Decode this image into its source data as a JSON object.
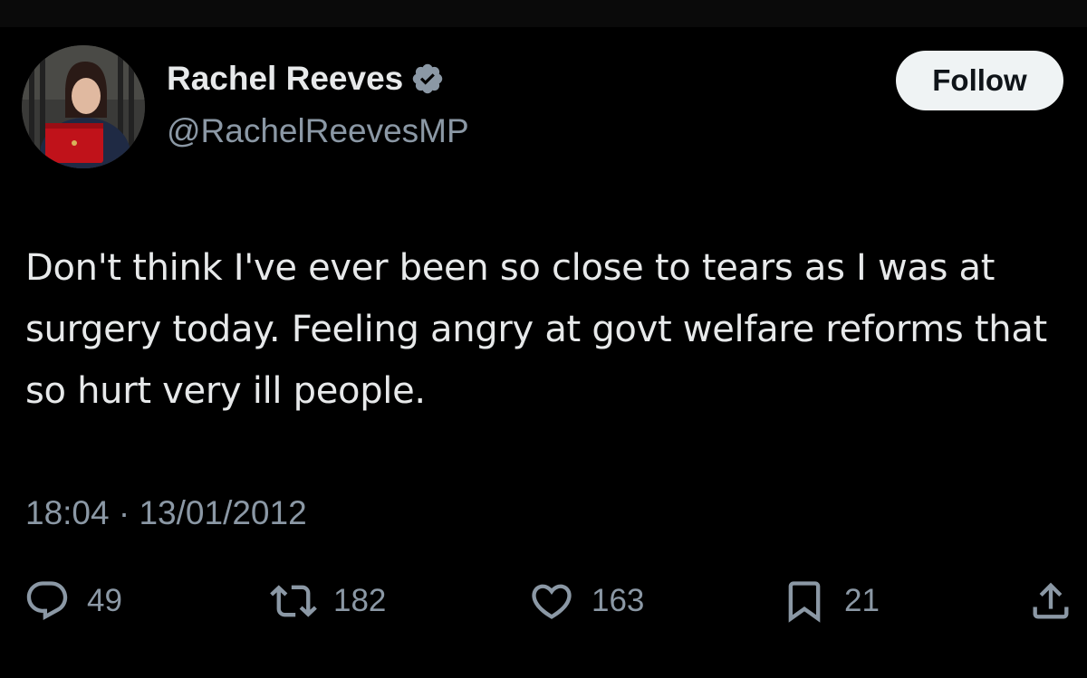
{
  "author": {
    "name": "Rachel Reeves",
    "handle": "@RachelReevesMP",
    "verified_icon": "verified-badge-icon"
  },
  "follow_label": "Follow",
  "tweet": {
    "text": "Don't think I've ever been so close to tears as I was at surgery today. Feeling angry at govt welfare reforms that so hurt very ill people.",
    "time": "18:04",
    "separator": "·",
    "date": "13/01/2012"
  },
  "actions": {
    "replies": "49",
    "retweets": "182",
    "likes": "163",
    "bookmarks": "21"
  },
  "colors": {
    "background": "#000000",
    "text": "#e7e9ea",
    "muted": "#8b98a5",
    "verified": "#8b98a5",
    "follow_bg": "#eff3f4"
  }
}
